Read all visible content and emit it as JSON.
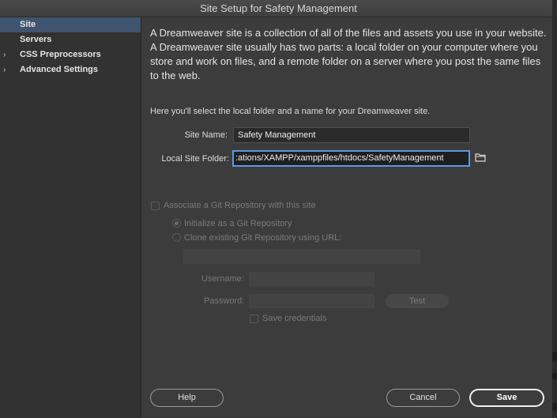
{
  "window": {
    "title": "Site Setup for Safety Management"
  },
  "sidebar": {
    "items": [
      {
        "label": "Site",
        "chevron": "",
        "selected": true
      },
      {
        "label": "Servers",
        "chevron": "",
        "selected": false
      },
      {
        "label": "CSS Preprocessors",
        "chevron": "›",
        "selected": false
      },
      {
        "label": "Advanced Settings",
        "chevron": "›",
        "selected": false
      }
    ]
  },
  "main": {
    "intro": "A Dreamweaver site is a collection of all of the files and assets you use in your website. A Dreamweaver site usually has two parts: a local folder on your computer where you store and work on files, and a remote folder on a server where you post the same files to the web.",
    "instruction": "Here you'll select the local folder and a name for your Dreamweaver site.",
    "site_name_label": "Site Name:",
    "site_name_value": "Safety Management",
    "local_folder_label": "Local Site Folder:",
    "local_folder_value": ":ations/XAMPP/xamppfiles/htdocs/SafetyManagement"
  },
  "git": {
    "associate_label": "Associate a Git Repository with this site",
    "init_label": "Initialize as a Git Repository",
    "clone_label": "Clone existing Git Repository using URL:",
    "username_label": "Username:",
    "password_label": "Password:",
    "test_label": "Test",
    "save_credentials_label": "Save credentials"
  },
  "footer": {
    "help_label": "Help",
    "cancel_label": "Cancel",
    "save_label": "Save"
  },
  "colors": {
    "selection": "#3f556f",
    "focus_ring": "#5a9ae8",
    "background": "#3c3c3c"
  },
  "icons": {
    "folder": "folder-icon",
    "chevron": "chevron-right-icon"
  }
}
